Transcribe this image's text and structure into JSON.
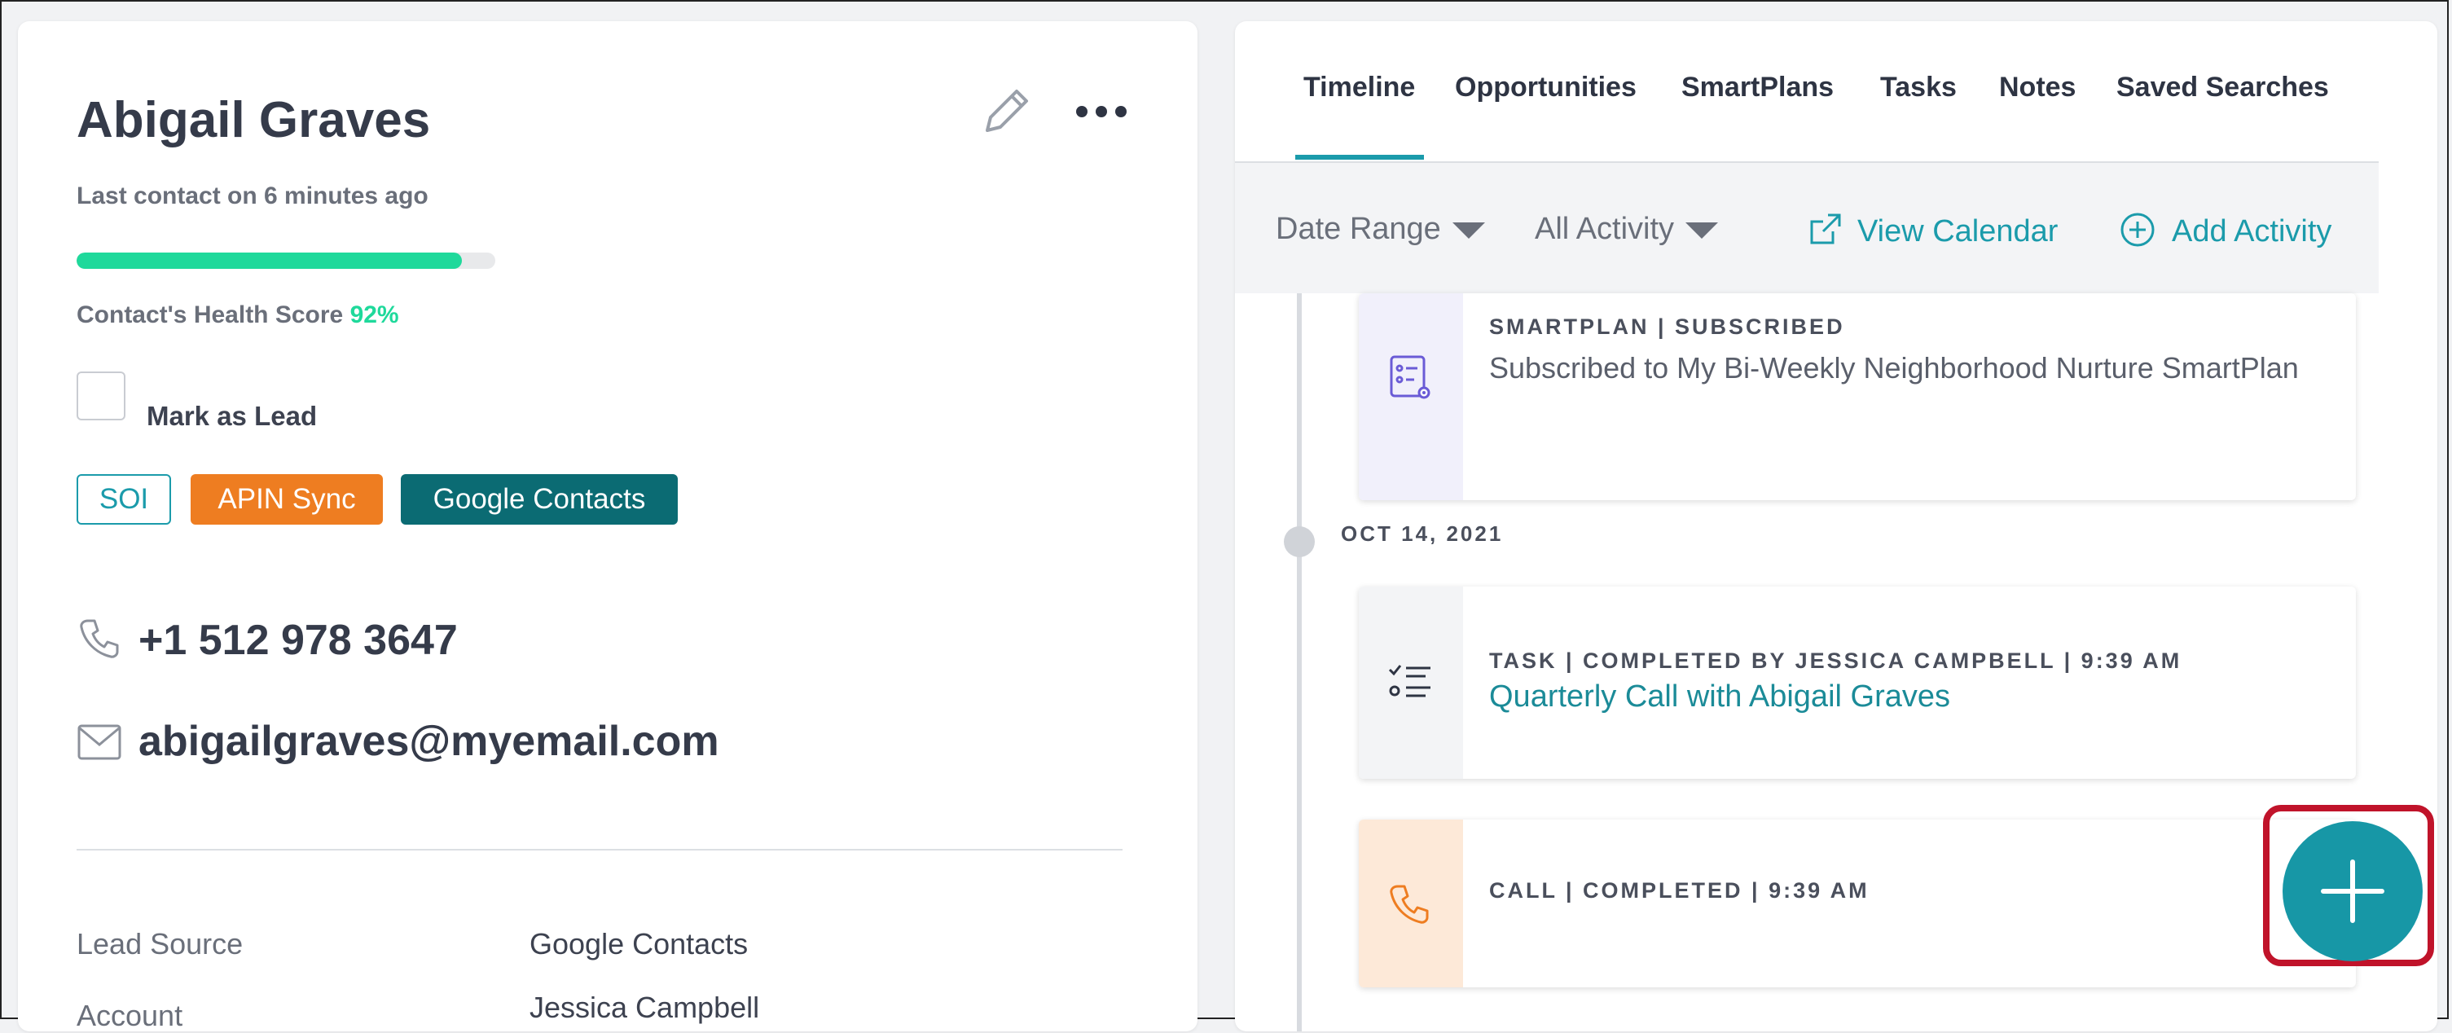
{
  "contact": {
    "name": "Abigail Graves",
    "last_contact": "Last contact on 6 minutes ago",
    "health_label": "Contact's Health Score",
    "health_score_text": "92%",
    "health_score": 0.92,
    "lead_label": "Mark as Lead",
    "lead_checked": false,
    "tags": [
      {
        "label": "SOI",
        "color": "#1b9bab"
      },
      {
        "label": "APIN Sync",
        "color": "#ee7d21"
      },
      {
        "label": "Google Contacts",
        "color": "#0b6b73"
      }
    ],
    "phone": "+1 512 978 3647",
    "email": "abigailgraves@myemail.com",
    "fields": [
      {
        "label": "Lead Source",
        "value": "Google Contacts"
      },
      {
        "label": "Account",
        "value": "Jessica Campbell"
      }
    ]
  },
  "tabs": [
    "Timeline",
    "Opportunities",
    "SmartPlans",
    "Tasks",
    "Notes",
    "Saved Searches"
  ],
  "active_tab": "Timeline",
  "toolbar": {
    "date_range": "Date Range",
    "activity_filter": "All Activity",
    "view_calendar": "View Calendar",
    "add_activity": "Add Activity"
  },
  "timeline": {
    "entries": [
      {
        "kicker": "SMARTPLAN | SUBSCRIBED",
        "text": "Subscribed to My Bi-Weekly Neighborhood Nurture SmartPlan",
        "icon": "smartplan-icon"
      },
      {
        "date": "OCT 14, 2021"
      },
      {
        "kicker": "TASK | COMPLETED BY JESSICA CAMPBELL | 9:39 AM",
        "link": "Quarterly Call with Abigail Graves",
        "icon": "task-list-icon"
      },
      {
        "kicker": "CALL | COMPLETED | 9:39 AM",
        "icon": "phone-icon"
      }
    ]
  },
  "colors": {
    "accent": "#1b9bab",
    "health": "#1fd99b",
    "highlight": "#c0132a"
  }
}
